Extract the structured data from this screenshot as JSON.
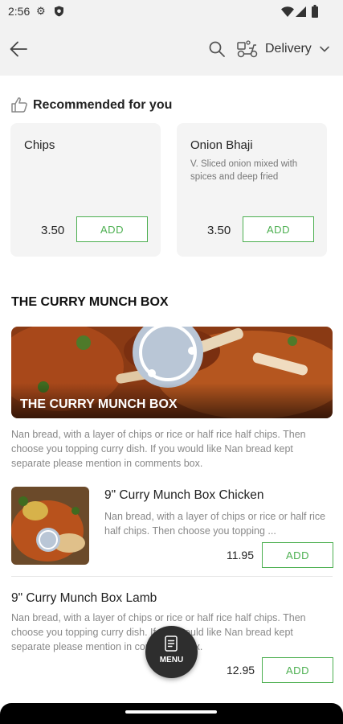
{
  "status_bar": {
    "time": "2:56"
  },
  "header": {
    "delivery_label": "Delivery"
  },
  "recommended": {
    "title": "Recommended for you",
    "items": [
      {
        "name": "Chips",
        "description": "",
        "price": "3.50",
        "add_label": "ADD"
      },
      {
        "name": "Onion Bhaji",
        "description": "V. Sliced onion mixed with spices and deep fried",
        "price": "3.50",
        "add_label": "ADD"
      }
    ]
  },
  "section": {
    "title": "THE CURRY MUNCH BOX",
    "banner_title": "THE CURRY MUNCH BOX",
    "description": "Nan bread, with a layer of chips or rice or half rice half chips. Then choose you topping curry dish. If you would like Nan bread kept separate please mention in comments box."
  },
  "items": [
    {
      "name": "9\" Curry Munch Box Chicken",
      "description": "Nan bread, with a layer of chips or rice or half rice half chips. Then choose you topping ...",
      "price": "11.95",
      "add_label": "ADD"
    },
    {
      "name": "9\" Curry Munch Box Lamb",
      "description": "Nan bread, with a layer of chips or rice or half rice half chips. Then choose you topping curry dish. If you would like Nan bread kept separate please mention in comments box.",
      "price": "12.95",
      "add_label": "ADD"
    }
  ],
  "fab": {
    "label": "MENU"
  },
  "colors": {
    "accent": "#4caf50",
    "appbar": "#f2f2f2",
    "card": "#f4f4f4",
    "fab": "#2e2e2e"
  }
}
